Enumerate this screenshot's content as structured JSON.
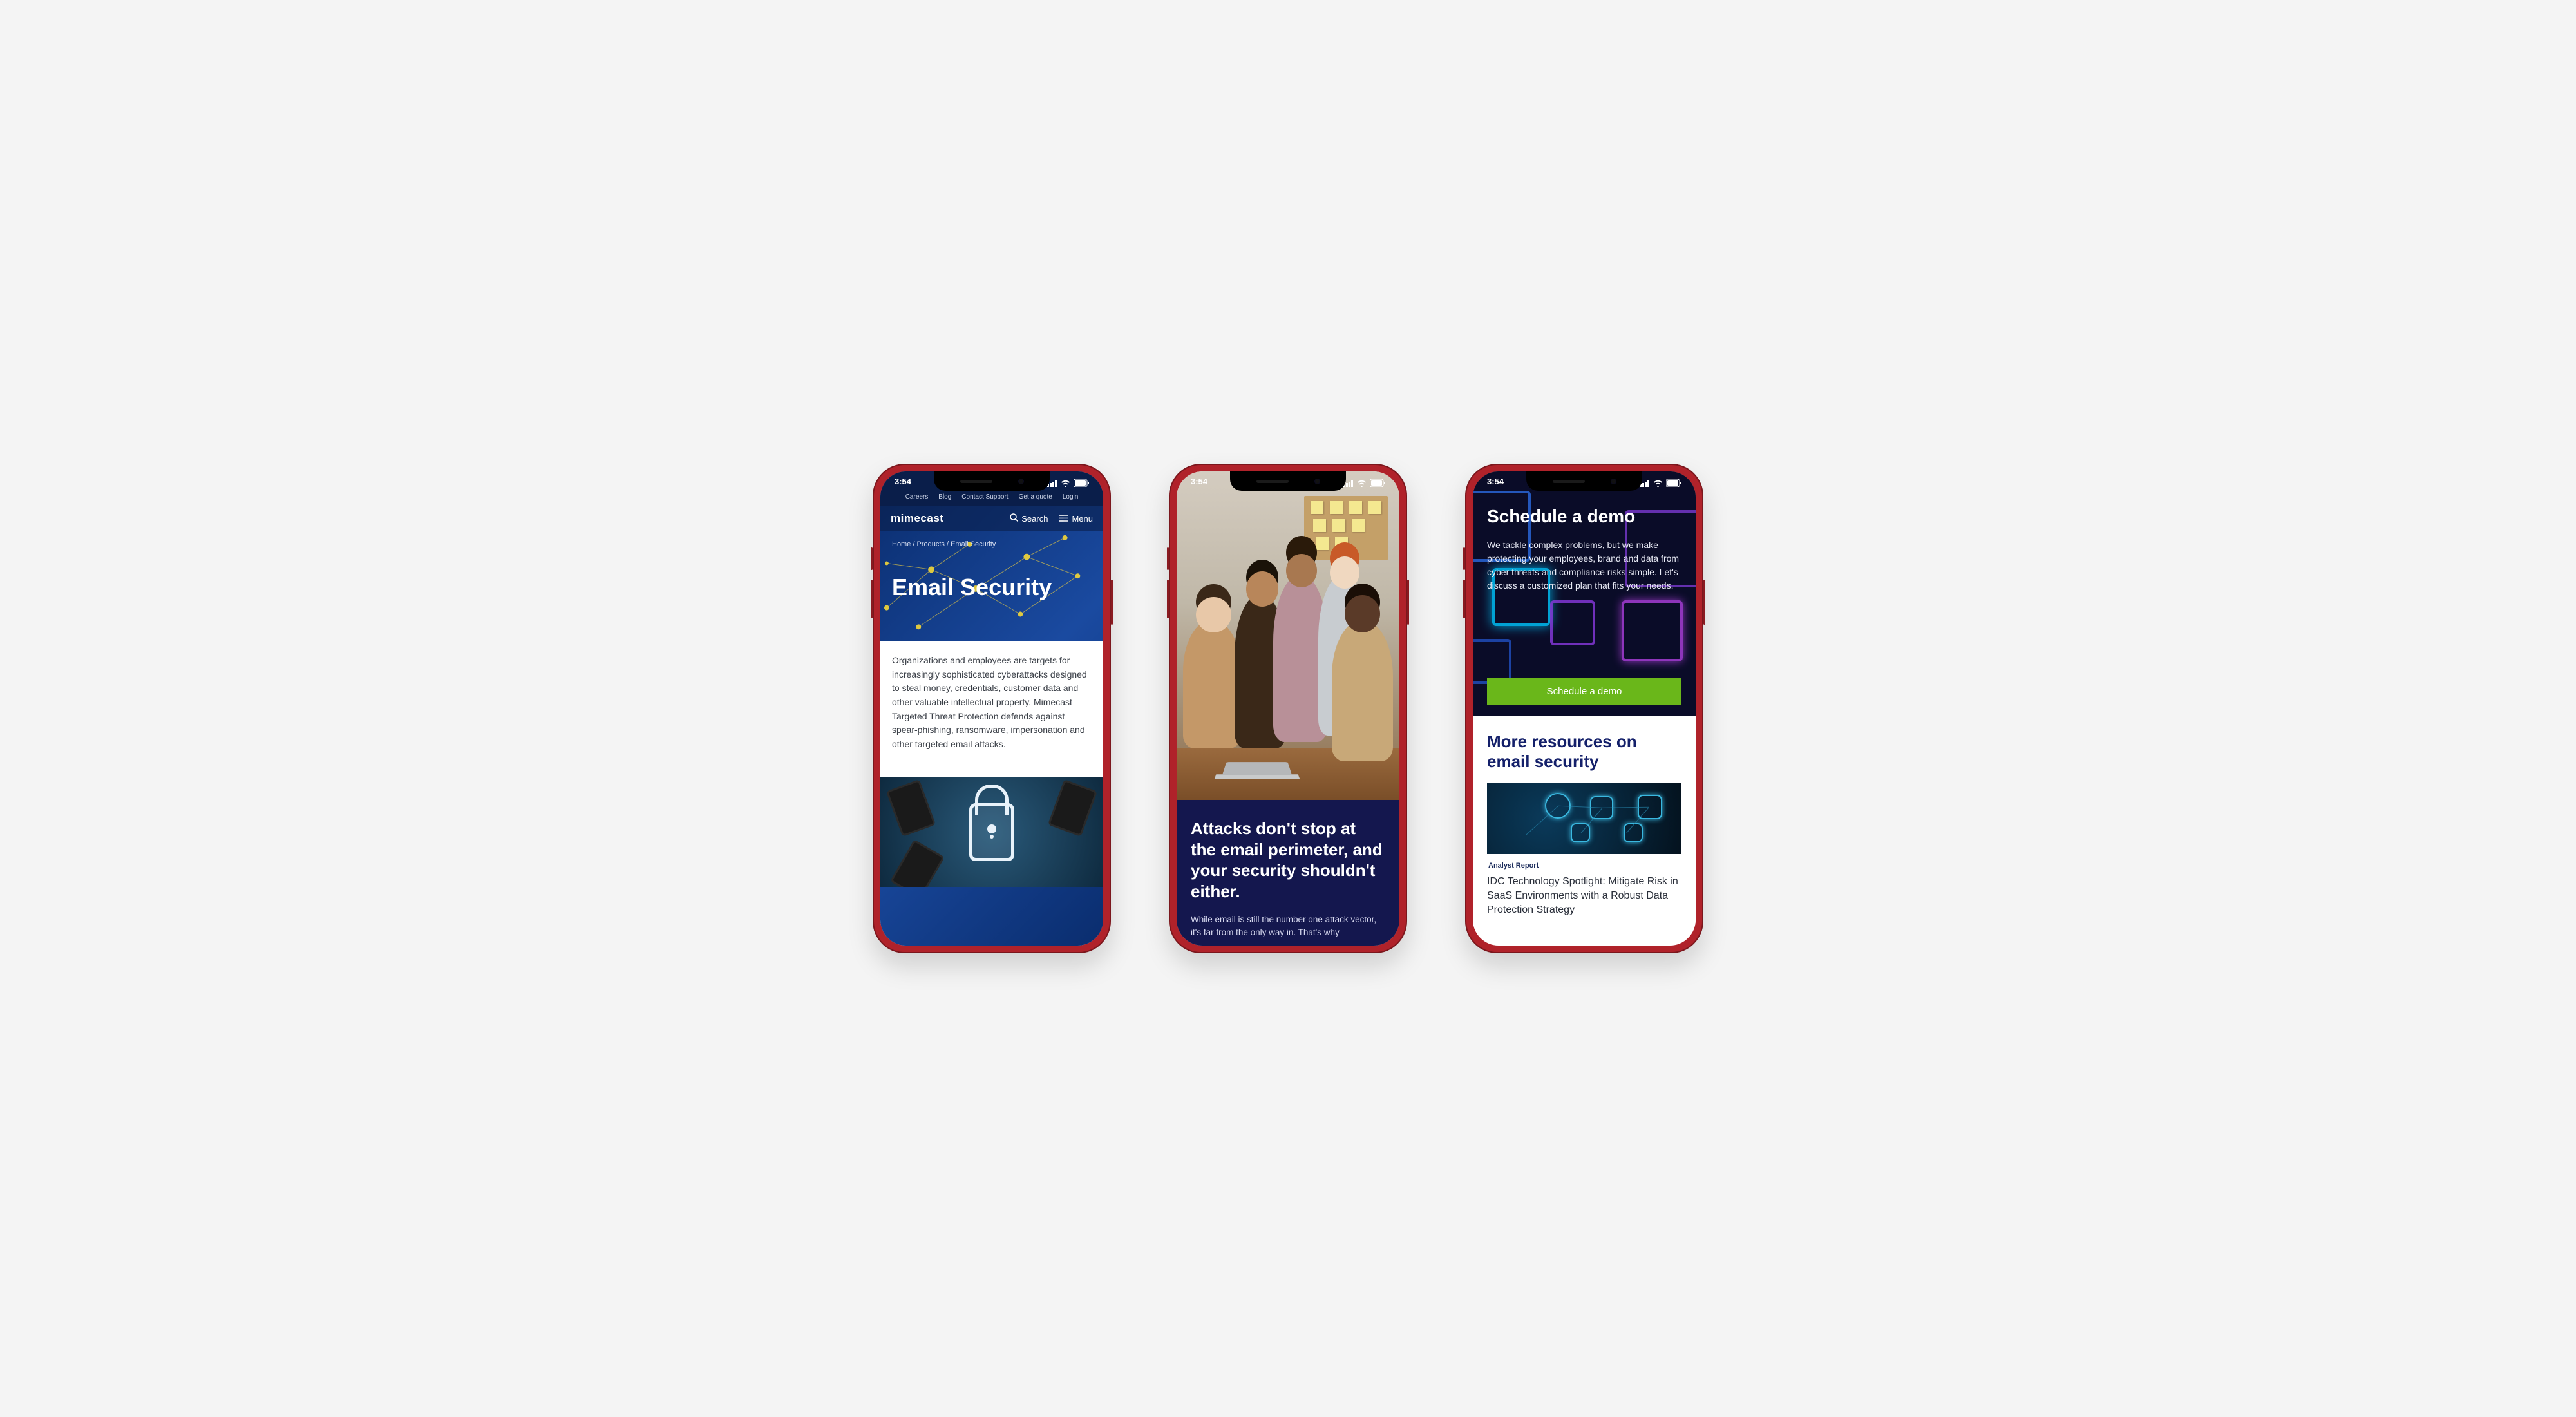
{
  "status_time": "3:54",
  "phone1": {
    "topnav": [
      "Careers",
      "Blog",
      "Contact Support",
      "Get a quote",
      "Login"
    ],
    "logo": "mimecast",
    "search_label": "Search",
    "menu_label": "Menu",
    "breadcrumb": "Home / Products / Email Security",
    "hero_title": "Email Security",
    "intro": "Organizations and employees are targets for increasingly sophisticated cyberattacks designed to steal money, credentials, customer data and other valuable intellectual property. Mimecast Targeted Threat Protection defends against spear-phishing, ransomware, impersonation and other targeted email attacks."
  },
  "phone2": {
    "heading": "Attacks don't stop at the email perimeter, and your security shouldn't either.",
    "body": "While email is still the number one attack vector, it's far from the only way in. That's why"
  },
  "phone3": {
    "demo_heading": "Schedule a demo",
    "demo_body": "We tackle complex problems, but we make protecting your employees, brand and data from cyber threats and compliance risks simple. Let's discuss a customized plan that fits your needs.",
    "demo_button": "Schedule a demo",
    "resources_heading": "More resources on email security",
    "card_type": "Analyst Report",
    "card_title": "IDC Technology Spotlight: Mitigate Risk in SaaS Environments with a Robust Data Protection Strategy"
  }
}
